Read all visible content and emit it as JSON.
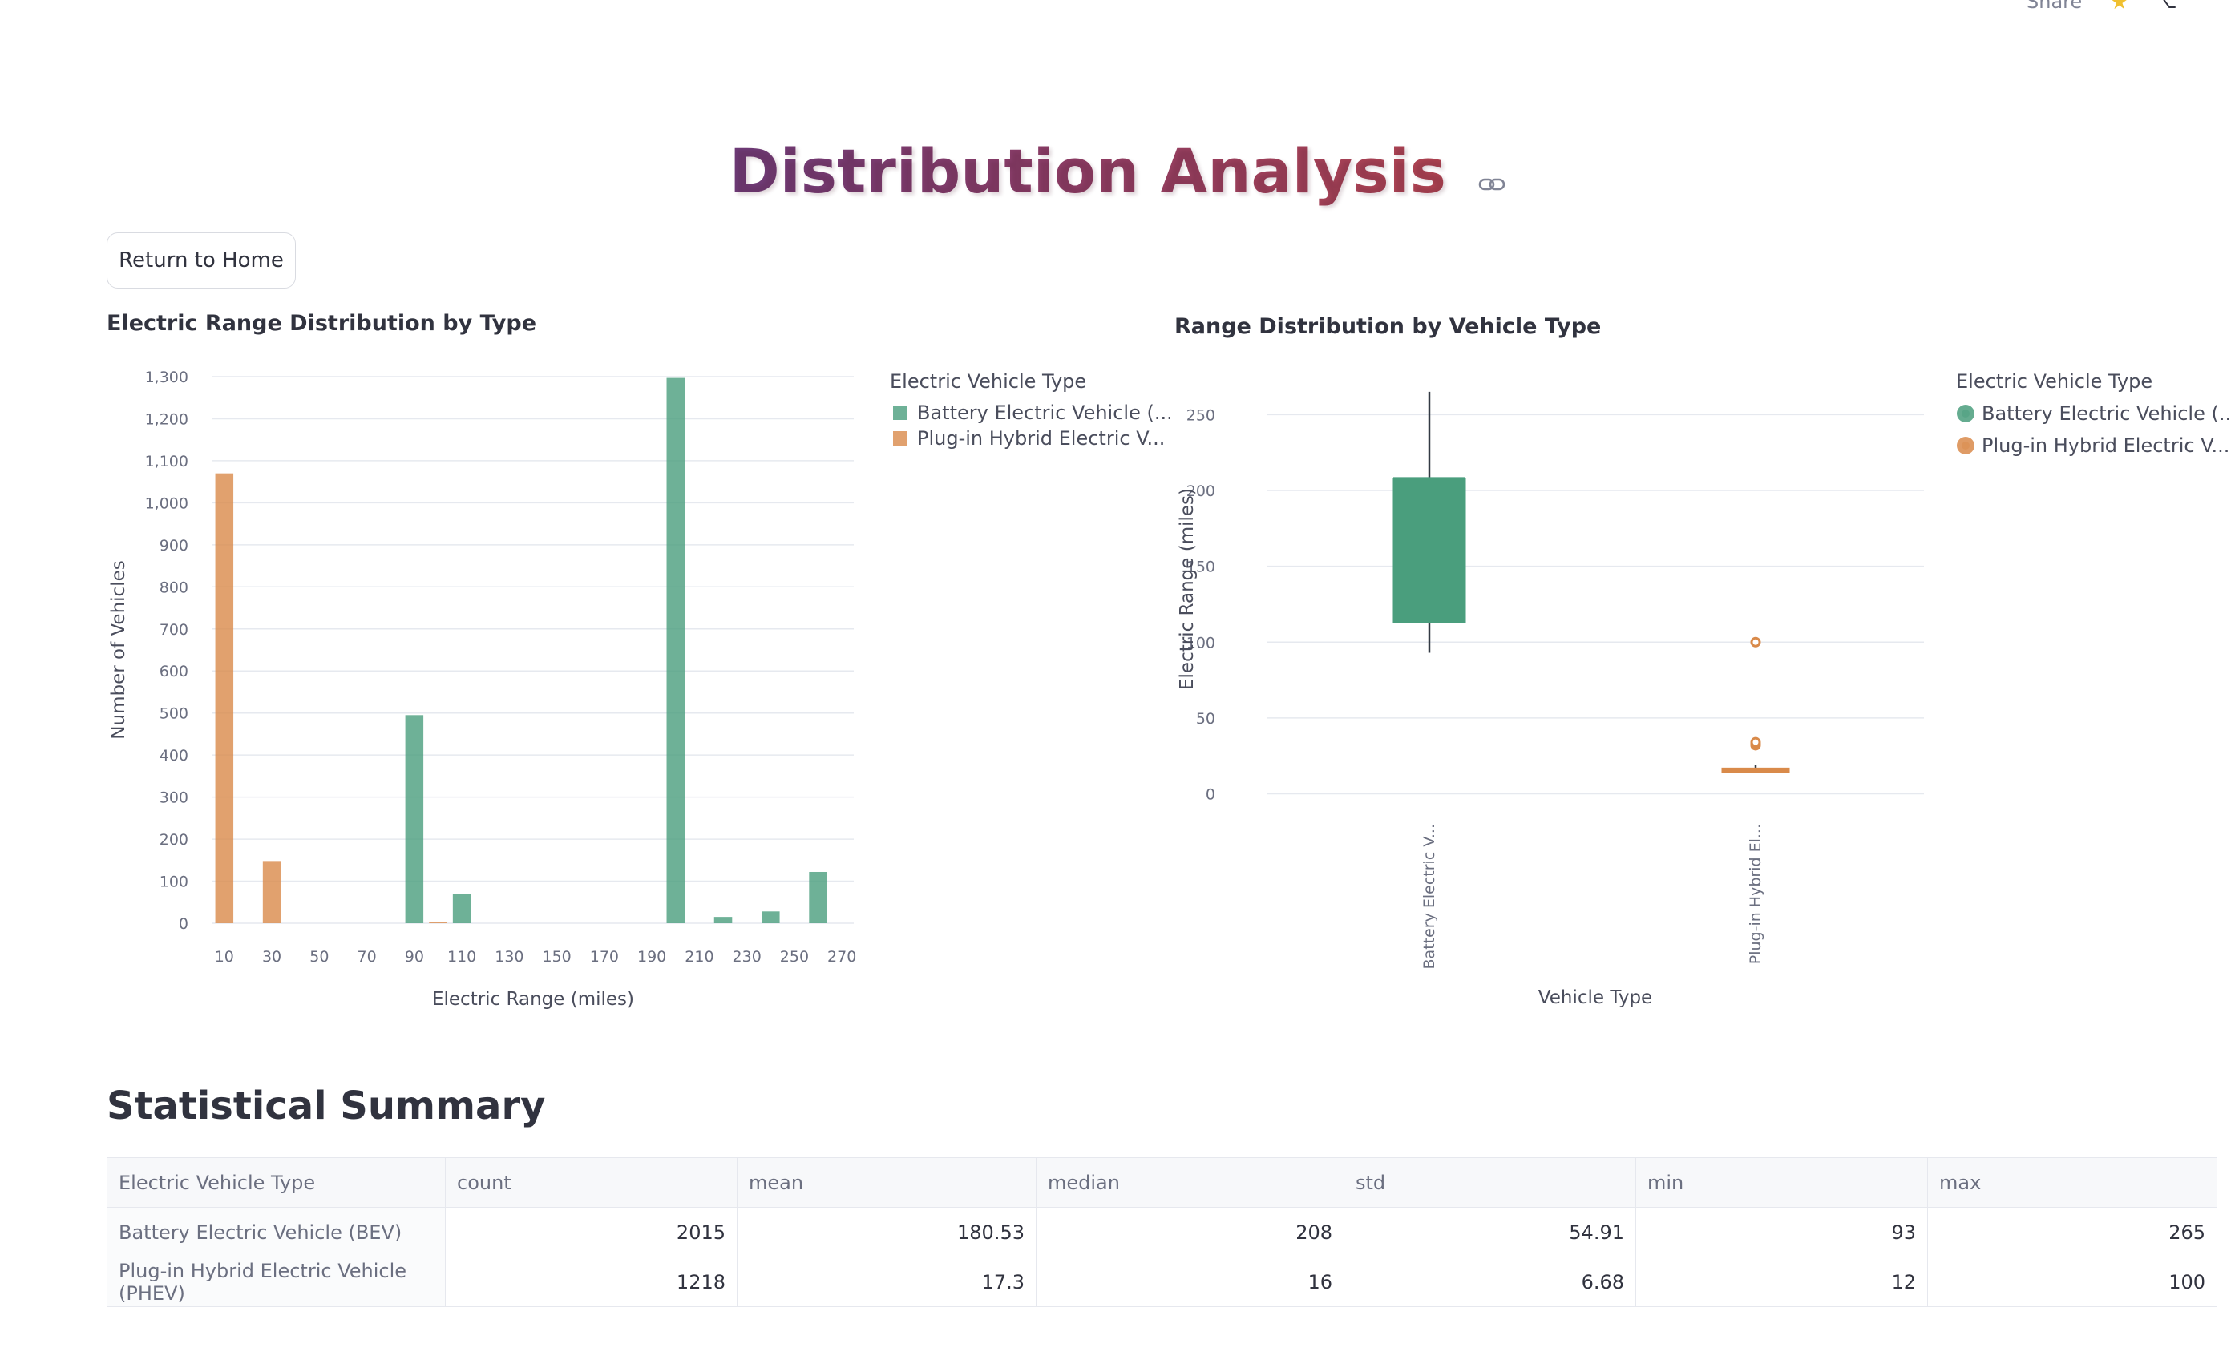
{
  "header": {
    "share_label": "Share",
    "star_icon": "star-icon",
    "github_icon": "github-icon"
  },
  "page": {
    "title": "Distribution Analysis",
    "link_icon": "link-icon",
    "return_button": "Return to Home"
  },
  "colors": {
    "bev": "#4a9e7d",
    "phev": "#d98a4a",
    "title_gradient": [
      "#6d3b78",
      "#b04451"
    ]
  },
  "chart_data": [
    {
      "type": "bar",
      "title": "Electric Range Distribution by Type",
      "xlabel": "Electric Range (miles)",
      "ylabel": "Number of Vehicles",
      "xlim": [
        5,
        275
      ],
      "ylim": [
        0,
        1300
      ],
      "x_ticks": [
        10,
        30,
        50,
        70,
        90,
        110,
        130,
        150,
        170,
        190,
        210,
        230,
        250,
        270
      ],
      "y_ticks": [
        0,
        100,
        200,
        300,
        400,
        500,
        600,
        700,
        800,
        900,
        1000,
        1100,
        1200,
        1300
      ],
      "y_tick_labels": [
        "0",
        "100",
        "200",
        "300",
        "400",
        "500",
        "600",
        "700",
        "800",
        "900",
        "1,000",
        "1,100",
        "1,200",
        "1,300"
      ],
      "bin_width": 10,
      "legend_title": "Electric Vehicle Type",
      "legend_position": "right",
      "series": [
        {
          "name": "Battery Electric Vehicle (...",
          "color": "#4a9e7d",
          "bins": [
            [
              90,
              495
            ],
            [
              110,
              70
            ],
            [
              200,
              1297
            ],
            [
              220,
              15
            ],
            [
              240,
              28
            ],
            [
              260,
              122
            ]
          ]
        },
        {
          "name": "Plug-in Hybrid Electric V...",
          "color": "#d98a4a",
          "bins": [
            [
              10,
              1070
            ],
            [
              30,
              148
            ],
            [
              100,
              3
            ]
          ]
        }
      ]
    },
    {
      "type": "box",
      "title": "Range Distribution by Vehicle Type",
      "xlabel": "Vehicle Type",
      "ylabel": "Electric Range (miles)",
      "ylim": [
        -5,
        275
      ],
      "y_ticks": [
        0,
        50,
        100,
        150,
        200,
        250
      ],
      "legend_title": "Electric Vehicle Type",
      "legend_position": "right",
      "categories": [
        "Battery Electric V...",
        "Plug-in Hybrid El..."
      ],
      "series": [
        {
          "name": "Battery Electric Vehicle (...",
          "color": "#4a9e7d",
          "min": 93,
          "q1": 113,
          "median": 208,
          "q3": 208,
          "max": 265,
          "outliers": []
        },
        {
          "name": "Plug-in Hybrid Electric V...",
          "color": "#d98a4a",
          "min": 14,
          "q1": 14,
          "median": 16,
          "q3": 17,
          "max": 19,
          "outliers": [
            100,
            32,
            33,
            34
          ]
        }
      ]
    }
  ],
  "summary": {
    "title": "Statistical Summary",
    "columns": [
      "Electric Vehicle Type",
      "count",
      "mean",
      "median",
      "std",
      "min",
      "max"
    ],
    "rows": [
      [
        "Battery Electric Vehicle (BEV)",
        "2015",
        "180.53",
        "208",
        "54.91",
        "93",
        "265"
      ],
      [
        "Plug-in Hybrid Electric Vehicle (PHEV)",
        "1218",
        "17.3",
        "16",
        "6.68",
        "12",
        "100"
      ]
    ]
  }
}
